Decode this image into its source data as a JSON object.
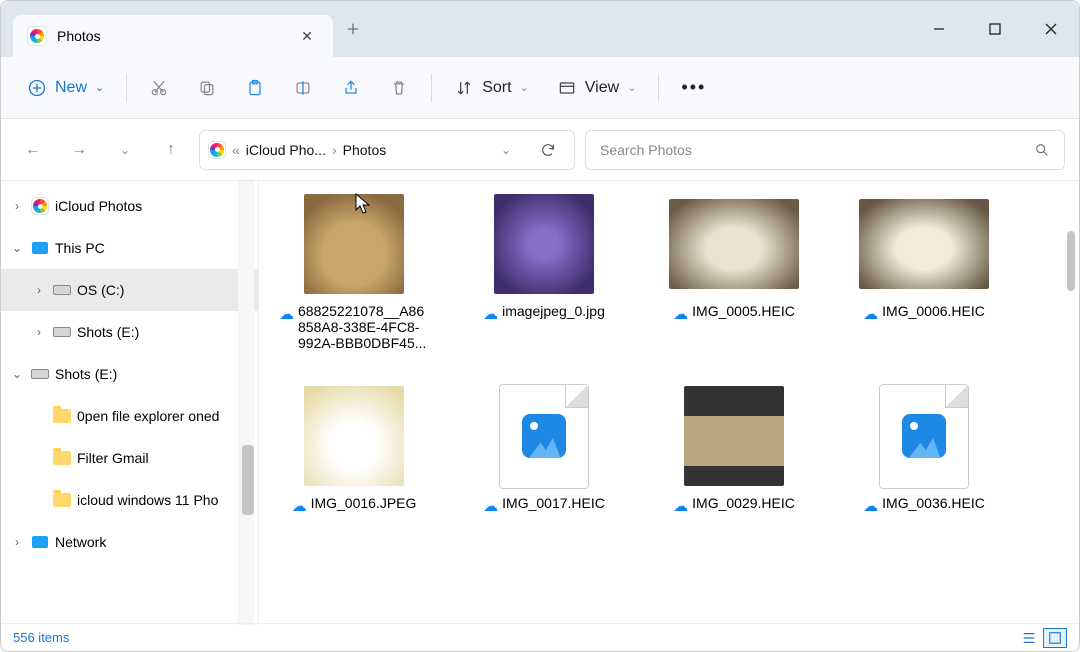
{
  "tab": {
    "title": "Photos"
  },
  "toolbar": {
    "new_label": "New",
    "sort_label": "Sort",
    "view_label": "View"
  },
  "breadcrumb": {
    "seg1": "iCloud Pho...",
    "seg2": "Photos"
  },
  "search": {
    "placeholder": "Search Photos"
  },
  "sidebar": {
    "items": [
      {
        "label": "iCloud Photos",
        "twist": "›",
        "icon": "photos"
      },
      {
        "label": "This PC",
        "twist": "⌄",
        "icon": "pc"
      },
      {
        "label": "OS (C:)",
        "twist": "›",
        "icon": "drive",
        "indent": 1,
        "selected": true
      },
      {
        "label": "Shots (E:)",
        "twist": "›",
        "icon": "drive",
        "indent": 1
      },
      {
        "label": "Shots (E:)",
        "twist": "⌄",
        "icon": "drive"
      },
      {
        "label": "0pen file explorer oned",
        "twist": "",
        "icon": "folder",
        "indent": 1
      },
      {
        "label": "Filter Gmail",
        "twist": "",
        "icon": "folder",
        "indent": 1
      },
      {
        "label": "icloud windows 11 Pho",
        "twist": "",
        "icon": "folder",
        "indent": 1
      },
      {
        "label": "Network",
        "twist": "›",
        "icon": "pc"
      }
    ]
  },
  "files": [
    {
      "name": "68825221078__A86858A8-338E-4FC8-992A-BBB0DBF45...",
      "thumb": "t1",
      "shape": "square"
    },
    {
      "name": "imagejpeg_0.jpg",
      "thumb": "t2",
      "shape": "square"
    },
    {
      "name": "IMG_0005.HEIC",
      "thumb": "t3",
      "shape": "wide"
    },
    {
      "name": "IMG_0006.HEIC",
      "thumb": "t4",
      "shape": "wide"
    },
    {
      "name": "IMG_0016.JPEG",
      "thumb": "t5",
      "shape": "square"
    },
    {
      "name": "IMG_0017.HEIC",
      "thumb": "generic"
    },
    {
      "name": "IMG_0029.HEIC",
      "thumb": "t6",
      "shape": "square"
    },
    {
      "name": "IMG_0036.HEIC",
      "thumb": "generic"
    }
  ],
  "status": {
    "text": "556 items"
  }
}
